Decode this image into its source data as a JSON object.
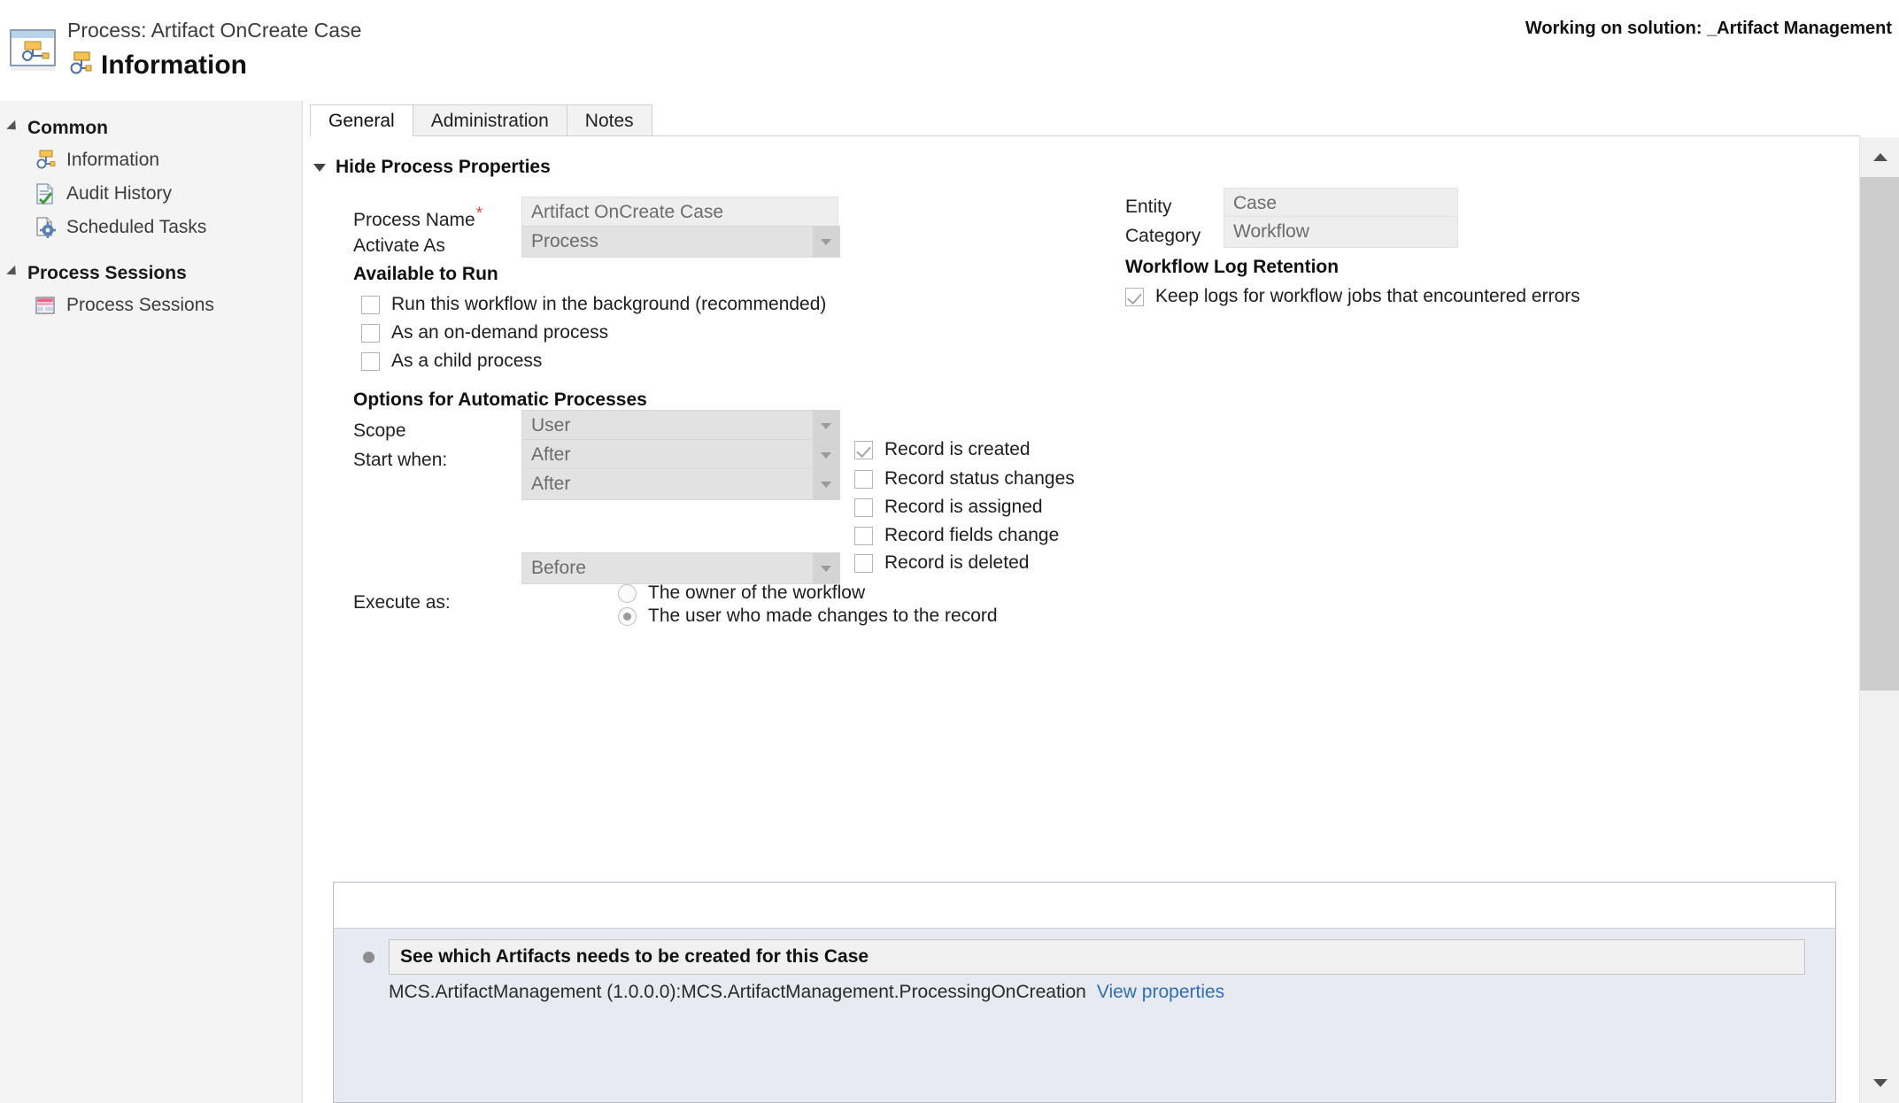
{
  "header": {
    "breadcrumb": "Process: Artifact OnCreate Case",
    "page_title": "Information",
    "solution_text": "Working on solution: _Artifact Management",
    "window_icon": "process-window-icon",
    "title_icon": "process-node-icon"
  },
  "sidebar": {
    "groups": [
      {
        "label": "Common",
        "items": [
          {
            "label": "Information",
            "icon": "process-node-icon"
          },
          {
            "label": "Audit History",
            "icon": "document-check-icon"
          },
          {
            "label": "Scheduled Tasks",
            "icon": "document-gear-icon"
          }
        ]
      },
      {
        "label": "Process Sessions",
        "items": [
          {
            "label": "Process Sessions",
            "icon": "grid-table-icon"
          }
        ]
      }
    ]
  },
  "tabs": [
    {
      "label": "General",
      "active": true
    },
    {
      "label": "Administration",
      "active": false
    },
    {
      "label": "Notes",
      "active": false
    }
  ],
  "form": {
    "section_toggle_label": "Hide Process Properties",
    "process_name_label": "Process Name",
    "process_name_required": "*",
    "process_name_value": "Artifact OnCreate Case",
    "activate_as_label": "Activate As",
    "activate_as_value": "Process",
    "entity_label": "Entity",
    "entity_value": "Case",
    "category_label": "Category",
    "category_value": "Workflow",
    "available_to_run_title": "Available to Run",
    "available_to_run": [
      {
        "label": "Run this workflow in the background (recommended)",
        "checked": false
      },
      {
        "label": "As an on-demand process",
        "checked": false
      },
      {
        "label": "As a child process",
        "checked": false
      }
    ],
    "workflow_log_retention_title": "Workflow Log Retention",
    "keep_logs": {
      "label": "Keep logs for workflow jobs that encountered errors",
      "checked": true
    },
    "automatic_options_title": "Options for Automatic Processes",
    "scope_label": "Scope",
    "scope_value": "User",
    "start_when_label": "Start when:",
    "start_when_1_value": "After",
    "start_when_2_value": "After",
    "start_when_3_value": "Before",
    "triggers": [
      {
        "label": "Record is created",
        "checked": true
      },
      {
        "label": "Record status changes",
        "checked": false
      },
      {
        "label": "Record is assigned",
        "checked": false
      },
      {
        "label": "Record fields change",
        "checked": false
      },
      {
        "label": "Record is deleted",
        "checked": false
      }
    ],
    "execute_as_label": "Execute as:",
    "execute_as_options": [
      {
        "label": "The owner of the workflow",
        "selected": false
      },
      {
        "label": "The user who made changes to the record",
        "selected": true
      }
    ]
  },
  "steps": {
    "step_title": "See which Artifacts needs to be created for this Case",
    "step_detail": "MCS.ArtifactManagement (1.0.0.0):MCS.ArtifactManagement.ProcessingOnCreation",
    "step_link": "View properties"
  },
  "scrollbar": {
    "up_arrow": "chevron-up-icon",
    "down_arrow": "chevron-down-icon"
  },
  "colors": {
    "accent_link": "#2f6fb5",
    "required_star": "#e8483c",
    "sidebar_bg": "#f4f4f4",
    "panel_bg": "#e7eaf1"
  }
}
